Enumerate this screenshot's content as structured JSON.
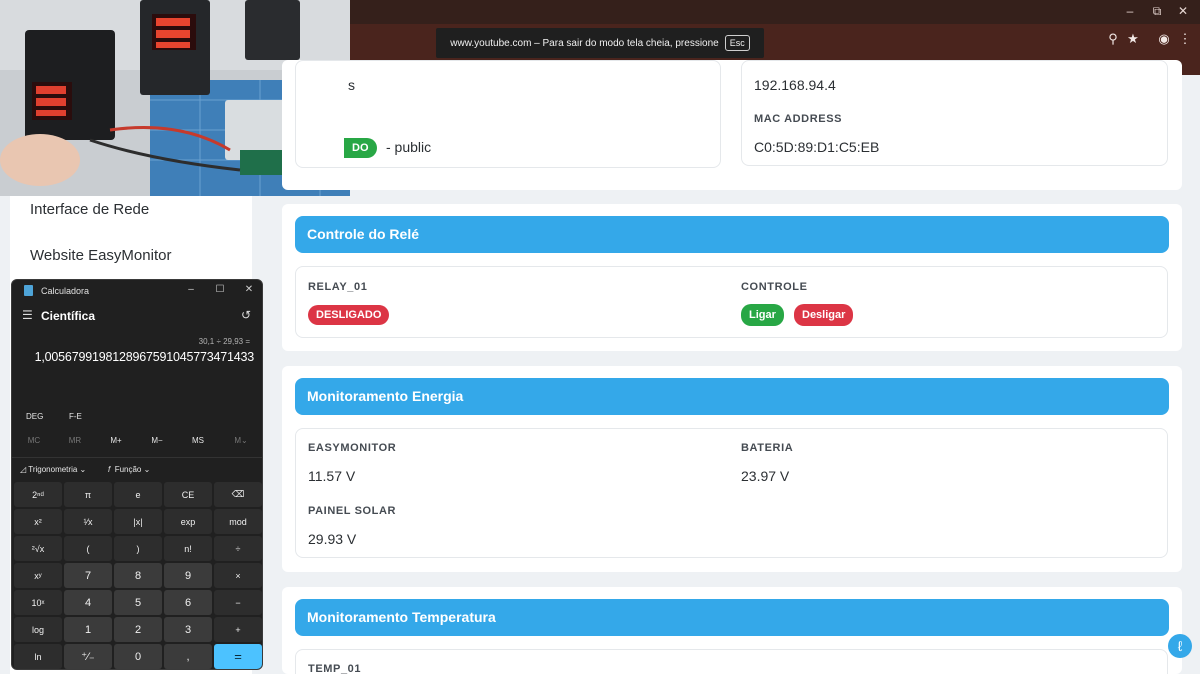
{
  "browser": {
    "fullscreen_message": "www.youtube.com – Para sair do modo tela cheia, pressione",
    "fullscreen_key": "Esc"
  },
  "sidebar": {
    "items": [
      {
        "label": "Interface de Rede"
      },
      {
        "label": "Website EasyMonitor"
      }
    ]
  },
  "network": {
    "partial_label": "s",
    "ip_value": "192.168.94.4",
    "mac_label": "MAC ADDRESS",
    "mac_value": "C0:5D:89:D1:C5:EB",
    "community_badge": "DO",
    "community_text": "- public"
  },
  "relay": {
    "title": "Controle do Relé",
    "relay_label": "RELAY_01",
    "relay_state": "DESLIGADO",
    "control_label": "CONTROLE",
    "on_button": "Ligar",
    "off_button": "Desligar"
  },
  "energy": {
    "title": "Monitoramento Energia",
    "easymonitor_label": "EASYMONITOR",
    "easymonitor_value": "11.57 V",
    "battery_label": "BATERIA",
    "battery_value": "23.97 V",
    "solar_label": "PAINEL SOLAR",
    "solar_value": "29.93 V"
  },
  "temperature": {
    "title": "Monitoramento Temperatura",
    "temp_label": "TEMP_01"
  },
  "calculator": {
    "window_title": "Calculadora",
    "mode": "Científica",
    "expression": "30,1 ÷ 29,93 =",
    "result": "1,0056799198128967591045773471433",
    "angle_mode": "DEG",
    "fe_label": "F-E",
    "memory": [
      "MC",
      "MR",
      "M+",
      "M−",
      "MS",
      "M⌄"
    ],
    "trig_label": "Trigonometria",
    "function_label": "Função",
    "keys": [
      "2ⁿᵈ",
      "π",
      "e",
      "CE",
      "⌫",
      "x²",
      "¹⁄x",
      "|x|",
      "exp",
      "mod",
      "²√x",
      "(",
      ")",
      "n!",
      "÷",
      "xʸ",
      "7",
      "8",
      "9",
      "×",
      "10ˣ",
      "4",
      "5",
      "6",
      "−",
      "log",
      "1",
      "2",
      "3",
      "+",
      "ln",
      "⁺⁄₋",
      "0",
      ",",
      "="
    ]
  },
  "colors": {
    "accent": "#34a8e9",
    "danger": "#dc3545",
    "success": "#28a745",
    "calc_equals": "#4cc2ff"
  }
}
